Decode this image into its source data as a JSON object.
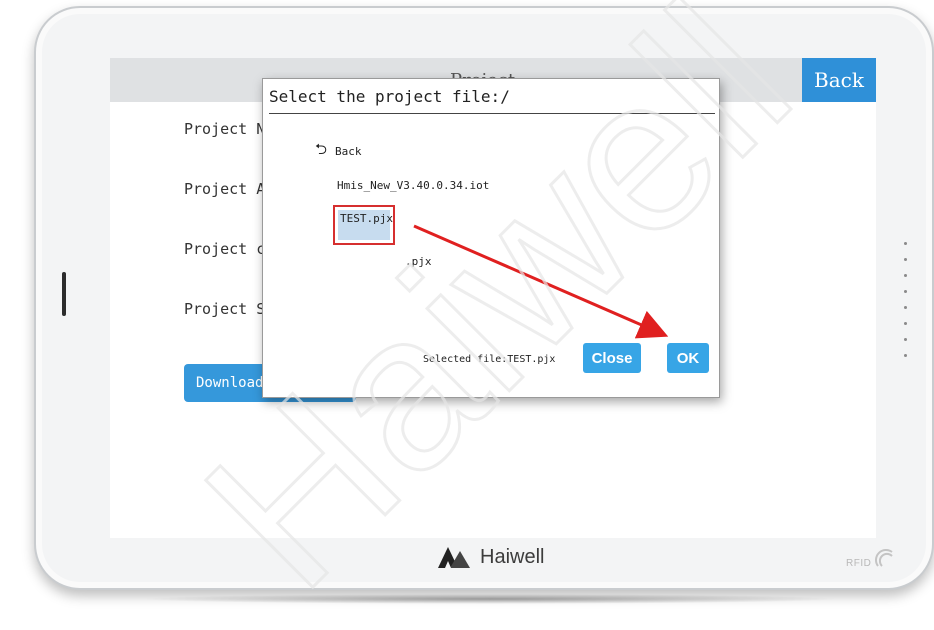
{
  "device": {
    "brand": "Haiwell",
    "rfid_label": "RFID"
  },
  "screen": {
    "title": "Project",
    "back_label": "Back",
    "fields": [
      {
        "label": "Project N"
      },
      {
        "label": "Project A"
      },
      {
        "label": "Project c"
      },
      {
        "label": "Project S"
      }
    ],
    "download_label": "Download"
  },
  "dialog": {
    "title": "Select the project file:/",
    "items": {
      "back": "Back",
      "file1": "Hmis_New_V3.40.0.34.iot",
      "file2": "TEST.pjx",
      "file3": ".pjx"
    },
    "selected_file_text": "Selected file:TEST.pjx",
    "close_label": "Close",
    "ok_label": "OK"
  },
  "watermark": "Haiwell",
  "colors": {
    "accent_blue": "#2f90d8",
    "button_blue": "#37a5e6",
    "highlight_red": "#d62f2f",
    "selection_bg": "#c7dcef"
  }
}
